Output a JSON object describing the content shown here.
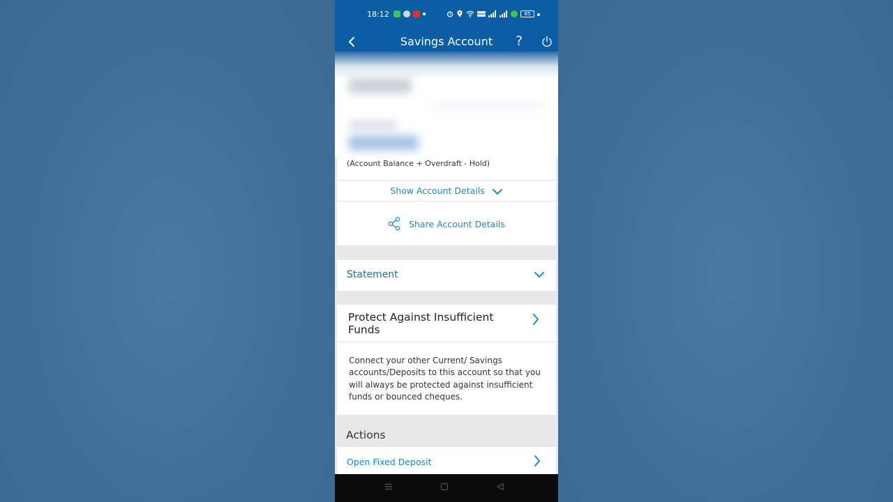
{
  "status_bar": {
    "time": "18:12",
    "battery": "85"
  },
  "header": {
    "title": "Savings Account",
    "help_label": "?"
  },
  "balance": {
    "note": "(Account Balance + Overdraft - Hold)"
  },
  "account_details": {
    "show_label": "Show Account Details",
    "share_label": "Share Account Details"
  },
  "statement": {
    "label": "Statement"
  },
  "protect": {
    "title": "Protect Against Insufficient Funds",
    "description": "Connect your other Current/ Savings accounts/Deposits to this account so that you will always be protected against insufficient funds or bounced cheques."
  },
  "actions": {
    "label": "Actions",
    "items": [
      {
        "label": "Open Fixed Deposit"
      }
    ]
  },
  "colors": {
    "header_blue": "#0c5ea4",
    "link_blue": "#1b8ac9",
    "page_gray": "#e8e8e8",
    "backdrop": "#41729b"
  },
  "icons": {
    "back": "chevron-left-icon",
    "help": "question-mark-icon",
    "power": "power-icon",
    "share": "share-icon",
    "expand": "chevron-down-icon",
    "navigate": "chevron-right-icon"
  }
}
